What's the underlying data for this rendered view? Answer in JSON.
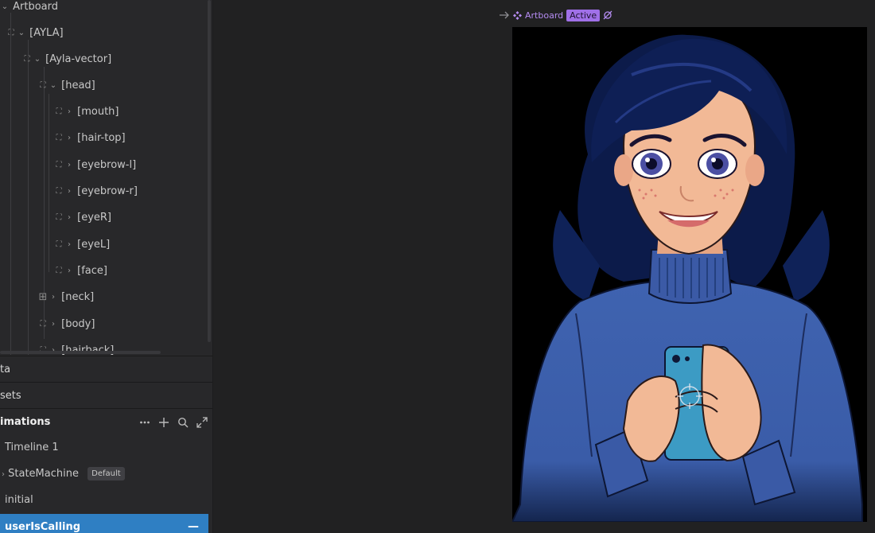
{
  "hierarchy": {
    "items": [
      {
        "label": "Artboard",
        "icon": "chevron-down-icon"
      },
      {
        "label": "[AYLA]",
        "icon": "group-icon"
      },
      {
        "label": "[Ayla-vector]",
        "icon": "group-icon"
      },
      {
        "label": "[head]",
        "icon": "group-icon"
      },
      {
        "label": "[mouth]",
        "icon": "group-icon"
      },
      {
        "label": "[hair-top]",
        "icon": "group-icon"
      },
      {
        "label": "[eyebrow-l]",
        "icon": "group-icon"
      },
      {
        "label": "[eyebrow-r]",
        "icon": "group-icon"
      },
      {
        "label": "[eyeR]",
        "icon": "group-icon"
      },
      {
        "label": "[eyeL]",
        "icon": "group-icon"
      },
      {
        "label": "[face]",
        "icon": "group-icon"
      },
      {
        "label": "[neck]",
        "icon": "component-icon"
      },
      {
        "label": "[body]",
        "icon": "group-icon"
      },
      {
        "label": "[hairback]",
        "icon": "group-icon"
      }
    ]
  },
  "panels": {
    "data_label": "ta",
    "assets_label": "sets",
    "animations_label": "imations"
  },
  "animations": {
    "items": [
      {
        "label": "Timeline 1"
      },
      {
        "label": "StateMachine",
        "badge": "Default"
      },
      {
        "label": "initial"
      },
      {
        "label": "userIsCalling",
        "selected": true
      }
    ]
  },
  "artboard": {
    "label": "Artboard",
    "state": "Active"
  },
  "colors": {
    "accent_purple": "#a070e8",
    "selection_blue": "#2f7fc3",
    "panel_bg": "#28282a",
    "canvas_bg": "#212122"
  }
}
